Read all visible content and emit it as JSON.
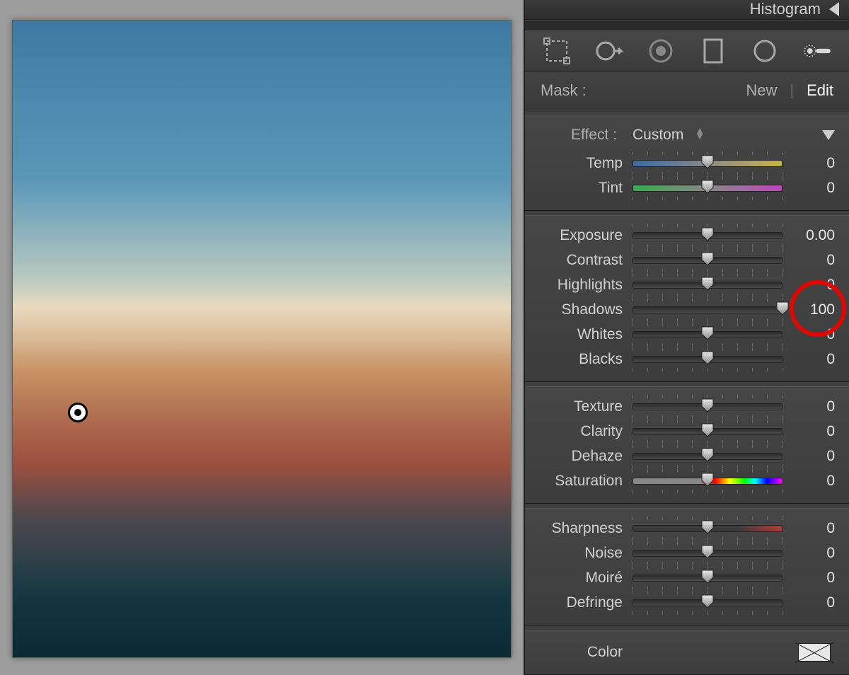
{
  "header": {
    "title": "Histogram"
  },
  "mask": {
    "label": "Mask :",
    "new": "New",
    "edit": "Edit"
  },
  "effect": {
    "label": "Effect :",
    "value": "Custom"
  },
  "sliders": {
    "group1": [
      {
        "label": "Temp",
        "value": "0",
        "pos": 50,
        "track": "track-temp"
      },
      {
        "label": "Tint",
        "value": "0",
        "pos": 50,
        "track": "track-tint"
      }
    ],
    "group2": [
      {
        "label": "Exposure",
        "value": "0.00",
        "pos": 50
      },
      {
        "label": "Contrast",
        "value": "0",
        "pos": 50
      },
      {
        "label": "Highlights",
        "value": "0",
        "pos": 50
      },
      {
        "label": "Shadows",
        "value": "100",
        "pos": 100,
        "hl": true
      },
      {
        "label": "Whites",
        "value": "0",
        "pos": 50
      },
      {
        "label": "Blacks",
        "value": "0",
        "pos": 50
      }
    ],
    "group3": [
      {
        "label": "Texture",
        "value": "0",
        "pos": 50
      },
      {
        "label": "Clarity",
        "value": "0",
        "pos": 50
      },
      {
        "label": "Dehaze",
        "value": "0",
        "pos": 50
      },
      {
        "label": "Saturation",
        "value": "0",
        "pos": 50,
        "track": "track-sat"
      }
    ],
    "group4": [
      {
        "label": "Sharpness",
        "value": "0",
        "pos": 50,
        "track": "track-sharp"
      },
      {
        "label": "Noise",
        "value": "0",
        "pos": 50
      },
      {
        "label": "Moiré",
        "value": "0",
        "pos": 50
      },
      {
        "label": "Defringe",
        "value": "0",
        "pos": 50
      }
    ]
  },
  "color": {
    "label": "Color"
  }
}
